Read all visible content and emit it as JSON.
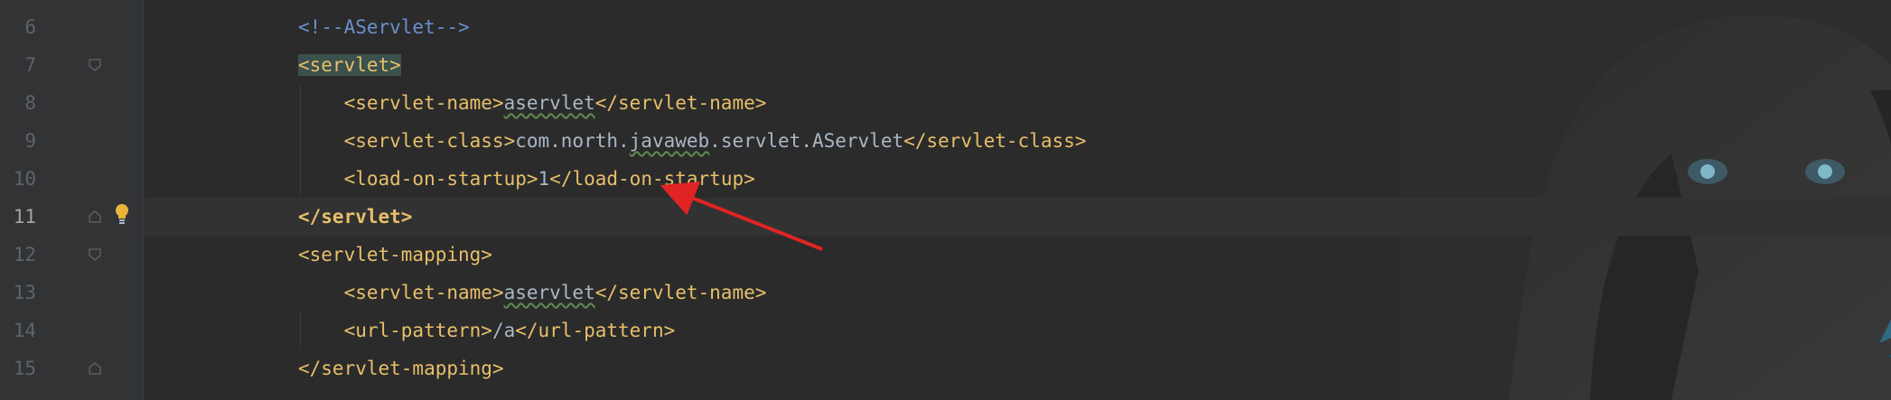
{
  "editor": {
    "lines": [
      {
        "num": "6",
        "parts": [
          {
            "t": "<!--AServlet-->",
            "c": "comment"
          }
        ]
      },
      {
        "num": "7",
        "parts": [
          {
            "t": "<servlet>",
            "c": "tag-hl"
          }
        ]
      },
      {
        "num": "8",
        "parts": [
          {
            "t": "    <servlet-name>",
            "c": "tag"
          },
          {
            "t": "aservlet",
            "c": "text squiggle"
          },
          {
            "t": "</servlet-name>",
            "c": "tag"
          }
        ]
      },
      {
        "num": "9",
        "parts": [
          {
            "t": "    <servlet-class>",
            "c": "tag"
          },
          {
            "t": "com.north.",
            "c": "text"
          },
          {
            "t": "javaweb",
            "c": "text squiggle"
          },
          {
            "t": ".servlet.AServlet",
            "c": "text"
          },
          {
            "t": "</servlet-class>",
            "c": "tag"
          }
        ]
      },
      {
        "num": "10",
        "parts": [
          {
            "t": "    <load-on-startup>",
            "c": "tag"
          },
          {
            "t": "1",
            "c": "text"
          },
          {
            "t": "</load-on-startup>",
            "c": "tag"
          }
        ]
      },
      {
        "num": "11",
        "parts": [
          {
            "t": "</servlet>",
            "c": "tag-bold"
          }
        ]
      },
      {
        "num": "12",
        "parts": [
          {
            "t": "<servlet-mapping>",
            "c": "tag"
          }
        ]
      },
      {
        "num": "13",
        "parts": [
          {
            "t": "    <servlet-name>",
            "c": "tag"
          },
          {
            "t": "aservlet",
            "c": "text squiggle"
          },
          {
            "t": "</servlet-name>",
            "c": "tag"
          }
        ]
      },
      {
        "num": "14",
        "parts": [
          {
            "t": "    <url-pattern>",
            "c": "tag"
          },
          {
            "t": "/a",
            "c": "text"
          },
          {
            "t": "</url-pattern>",
            "c": "tag"
          }
        ]
      },
      {
        "num": "15",
        "parts": [
          {
            "t": "</servlet-mapping>",
            "c": "tag"
          }
        ]
      }
    ],
    "current_line": "11",
    "colors": {
      "background": "#2b2b2b",
      "gutter": "#313335",
      "tag": "#e8bf6a",
      "comment": "#6a8fd0",
      "text": "#a9b7c6",
      "annotation_arrow": "#e02424"
    },
    "icons": {
      "fold": "fold-marker-icon",
      "intention": "lightbulb-icon"
    }
  }
}
